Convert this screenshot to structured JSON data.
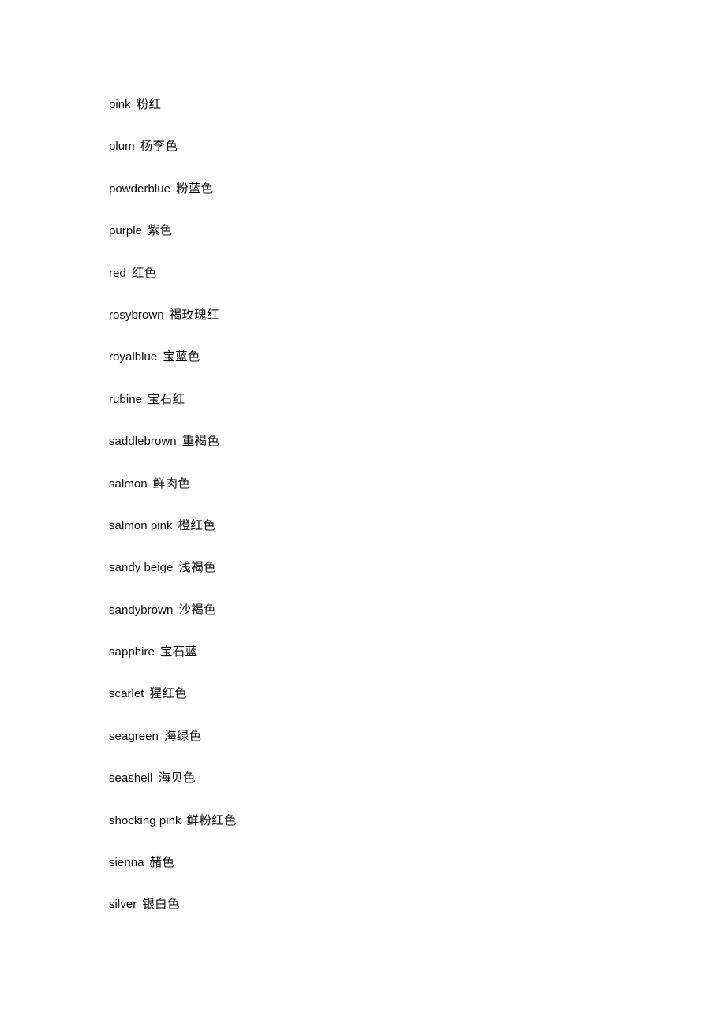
{
  "document": {
    "background_color": "#ffffff",
    "text_color": "#000000",
    "entries": [
      {
        "term": "pink",
        "gloss": "粉红"
      },
      {
        "term": "plum",
        "gloss": "杨李色"
      },
      {
        "term": "powderblue",
        "gloss": "粉蓝色"
      },
      {
        "term": "purple",
        "gloss": "紫色"
      },
      {
        "term": "red",
        "gloss": "红色"
      },
      {
        "term": "rosybrown",
        "gloss": "褐玫瑰红"
      },
      {
        "term": "royalblue",
        "gloss": "宝蓝色"
      },
      {
        "term": "rubine",
        "gloss": "宝石红"
      },
      {
        "term": "saddlebrown",
        "gloss": "重褐色"
      },
      {
        "term": "salmon",
        "gloss": "鲜肉色"
      },
      {
        "term": "salmon pink",
        "gloss": "橙红色"
      },
      {
        "term": "sandy beige",
        "gloss": "浅褐色"
      },
      {
        "term": "sandybrown",
        "gloss": "沙褐色"
      },
      {
        "term": "sapphire",
        "gloss": "宝石蓝"
      },
      {
        "term": "scarlet",
        "gloss": "猩红色"
      },
      {
        "term": "seagreen",
        "gloss": "海绿色"
      },
      {
        "term": "seashell",
        "gloss": "海贝色"
      },
      {
        "term": "shocking pink",
        "gloss": "鲜粉红色"
      },
      {
        "term": "sienna",
        "gloss": "赭色"
      },
      {
        "term": "silver",
        "gloss": "银白色"
      }
    ]
  }
}
